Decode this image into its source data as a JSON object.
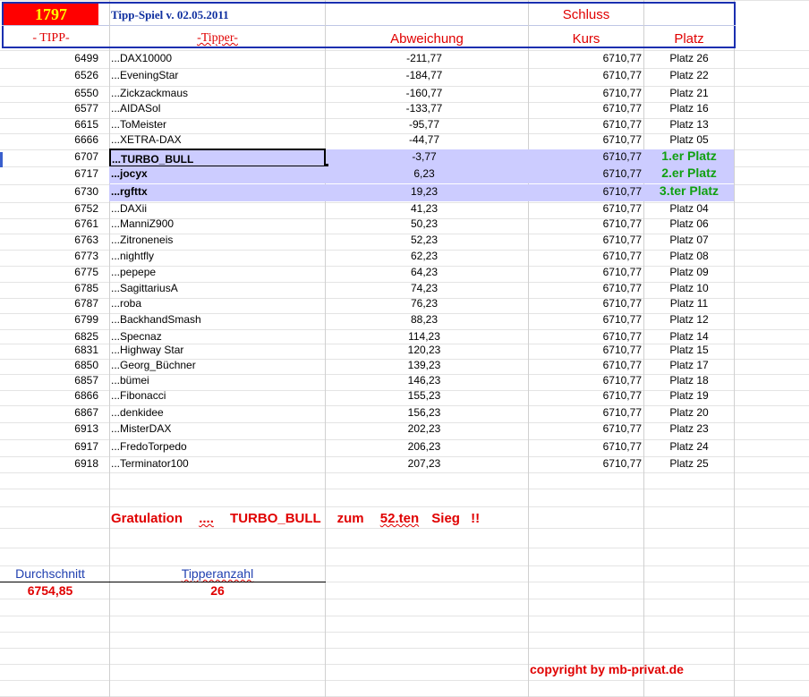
{
  "header": {
    "game_number": "1797",
    "title": "Tipp-Spiel v. 02.05.2011",
    "schluss": "Schluss",
    "col_tipp": "- TIPP-",
    "col_tipper": "-Tipper-",
    "col_abweichung": "Abweichung",
    "col_kurs": "Kurs",
    "col_platz": "Platz"
  },
  "rows": [
    {
      "tipp": "6499",
      "tipper": "...DAX10000",
      "abw": "-211,77",
      "kurs": "6710,77",
      "platz": "Platz 26"
    },
    {
      "tipp": "6526",
      "tipper": "...EveningStar",
      "abw": "-184,77",
      "kurs": "6710,77",
      "platz": "Platz 22"
    },
    {
      "tipp": "6550",
      "tipper": "...Zickzackmaus",
      "abw": "-160,77",
      "kurs": "6710,77",
      "platz": "Platz 21"
    },
    {
      "tipp": "6577",
      "tipper": "...AIDASol",
      "abw": "-133,77",
      "kurs": "6710,77",
      "platz": "Platz 16"
    },
    {
      "tipp": "6615",
      "tipper": "...ToMeister",
      "abw": "-95,77",
      "kurs": "6710,77",
      "platz": "Platz 13"
    },
    {
      "tipp": "6666",
      "tipper": "...XETRA-DAX",
      "abw": "-44,77",
      "kurs": "6710,77",
      "platz": "Platz 05"
    },
    {
      "tipp": "6707",
      "tipper": "...TURBO_BULL",
      "abw": "-3,77",
      "kurs": "6710,77",
      "platz": "1.er Platz"
    },
    {
      "tipp": "6717",
      "tipper": "...jocyx",
      "abw": "6,23",
      "kurs": "6710,77",
      "platz": "2.er Platz"
    },
    {
      "tipp": "6730",
      "tipper": "...rgfttx",
      "abw": "19,23",
      "kurs": "6710,77",
      "platz": "3.ter Platz"
    },
    {
      "tipp": "6752",
      "tipper": "...DAXii",
      "abw": "41,23",
      "kurs": "6710,77",
      "platz": "Platz 04"
    },
    {
      "tipp": "6761",
      "tipper": "...ManniZ900",
      "abw": "50,23",
      "kurs": "6710,77",
      "platz": "Platz 06"
    },
    {
      "tipp": "6763",
      "tipper": "...Zitroneneis",
      "abw": "52,23",
      "kurs": "6710,77",
      "platz": "Platz 07"
    },
    {
      "tipp": "6773",
      "tipper": "...nightfly",
      "abw": "62,23",
      "kurs": "6710,77",
      "platz": "Platz 08"
    },
    {
      "tipp": "6775",
      "tipper": "...pepepe",
      "abw": "64,23",
      "kurs": "6710,77",
      "platz": "Platz 09"
    },
    {
      "tipp": "6785",
      "tipper": "...SagittariusA",
      "abw": "74,23",
      "kurs": "6710,77",
      "platz": "Platz 10"
    },
    {
      "tipp": "6787",
      "tipper": "...roba",
      "abw": "76,23",
      "kurs": "6710,77",
      "platz": "Platz 11"
    },
    {
      "tipp": "6799",
      "tipper": "...BackhandSmash",
      "abw": "88,23",
      "kurs": "6710,77",
      "platz": "Platz 12"
    },
    {
      "tipp": "6825",
      "tipper": "...Specnaz",
      "abw": "114,23",
      "kurs": "6710,77",
      "platz": "Platz 14"
    },
    {
      "tipp": "6831",
      "tipper": "...Highway Star",
      "abw": "120,23",
      "kurs": "6710,77",
      "platz": "Platz 15"
    },
    {
      "tipp": "6850",
      "tipper": "...Georg_Büchner",
      "abw": "139,23",
      "kurs": "6710,77",
      "platz": "Platz 17"
    },
    {
      "tipp": "6857",
      "tipper": "...bümei",
      "abw": "146,23",
      "kurs": "6710,77",
      "platz": "Platz 18"
    },
    {
      "tipp": "6866",
      "tipper": "...Fibonacci",
      "abw": "155,23",
      "kurs": "6710,77",
      "platz": "Platz 19"
    },
    {
      "tipp": "6867",
      "tipper": "...denkidee",
      "abw": "156,23",
      "kurs": "6710,77",
      "platz": "Platz 20"
    },
    {
      "tipp": "6913",
      "tipper": "...MisterDAX",
      "abw": "202,23",
      "kurs": "6710,77",
      "platz": "Platz 23"
    },
    {
      "tipp": "6917",
      "tipper": "...FredoTorpedo",
      "abw": "206,23",
      "kurs": "6710,77",
      "platz": "Platz 24"
    },
    {
      "tipp": "6918",
      "tipper": "...Terminator100",
      "abw": "207,23",
      "kurs": "6710,77",
      "platz": "Platz 25"
    }
  ],
  "gratulation": {
    "word1": "Gratulation",
    "dots": "....",
    "name": "TURBO_BULL",
    "zum": "zum",
    "count": "52.ten",
    "sieg": "Sieg",
    "excl": "!!"
  },
  "summary": {
    "durchschnitt_label": "Durchschnitt",
    "durchschnitt_value": "6754,85",
    "tipperanzahl_label": "Tipperanzahl",
    "tipperanzahl_value": "26"
  },
  "copyright": "copyright by mb-privat.de",
  "colors": {
    "highlight_row": "#ccccff",
    "header_border": "#1a2fb0",
    "red": "#e00000",
    "green": "#10a010",
    "number_box_bg": "#ff0000",
    "number_box_text": "#ffff00"
  }
}
